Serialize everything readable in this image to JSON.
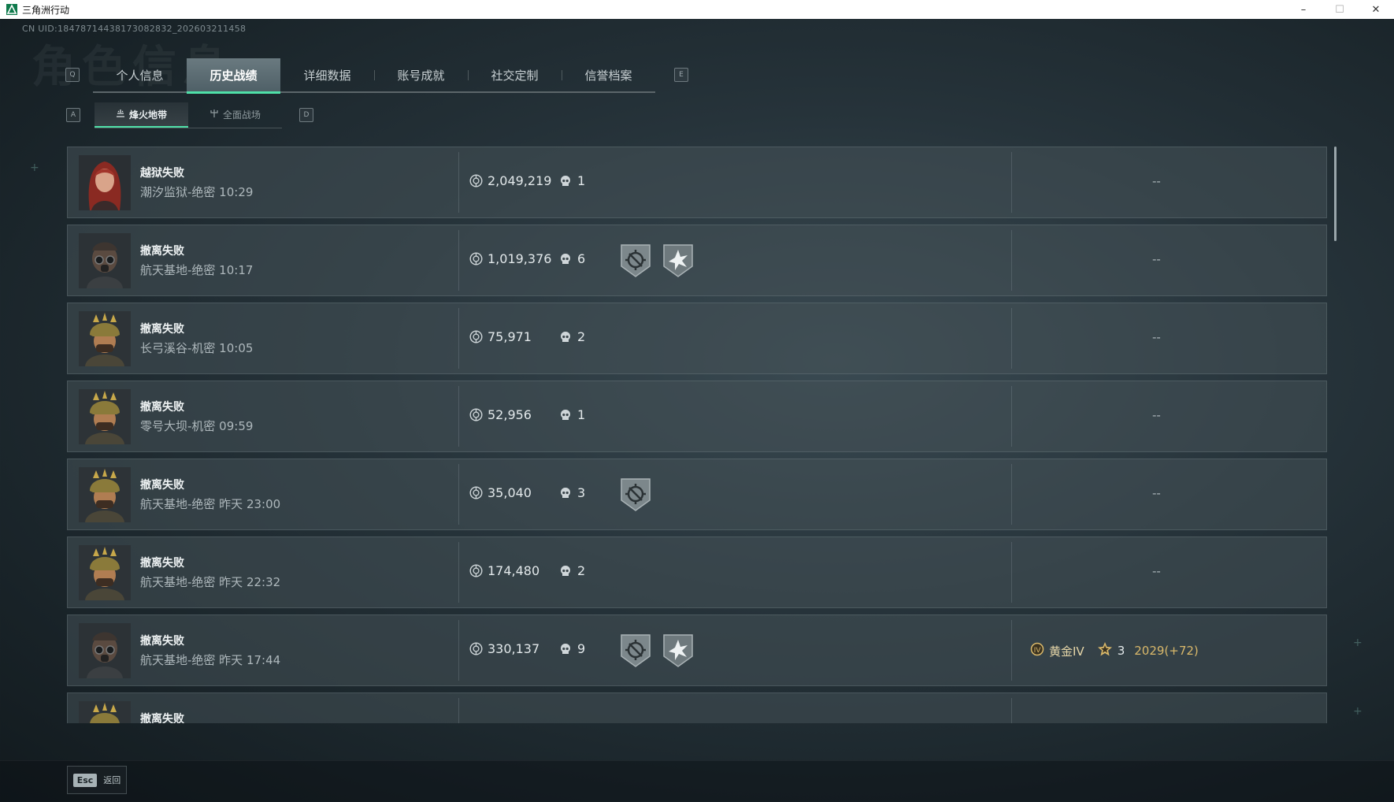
{
  "window": {
    "title": "三角洲行动",
    "minimize": "–",
    "maximize": "☐",
    "close": "✕"
  },
  "uid": "CN UID:18478714438173082832_202603211458",
  "bg_title": "角色信息",
  "key_hints": {
    "prev_tab": "Q",
    "next_tab": "E",
    "prev_sub": "A",
    "next_sub": "D"
  },
  "tabs": [
    "个人信息",
    "历史战绩",
    "详细数据",
    "账号成就",
    "社交定制",
    "信誉档案"
  ],
  "active_tab": "历史战绩",
  "subtabs": [
    "烽火地带",
    "全面战场"
  ],
  "active_subtab": "烽火地带",
  "rows": [
    {
      "result": "越狱失败",
      "map": "潮汐监狱-绝密 10:29",
      "value": "2,049,219",
      "kills": "1",
      "avatar": "female-red-hair",
      "badges": [],
      "rank_text": "--"
    },
    {
      "result": "撤离失败",
      "map": "航天基地-绝密 10:17",
      "value": "1,019,376",
      "kills": "6",
      "avatar": "gasmask-operator",
      "badges": [
        "crosshair-badge-icon",
        "burst-badge-icon"
      ],
      "rank_text": "--"
    },
    {
      "result": "撤离失败",
      "map": "长弓溪谷-机密 10:05",
      "value": "75,971",
      "kills": "2",
      "avatar": "gold-helmet-operator",
      "badges": [],
      "rank_text": "--"
    },
    {
      "result": "撤离失败",
      "map": "零号大坝-机密 09:59",
      "value": "52,956",
      "kills": "1",
      "avatar": "gold-helmet-operator",
      "badges": [],
      "rank_text": "--"
    },
    {
      "result": "撤离失败",
      "map": "航天基地-绝密 昨天 23:00",
      "value": "35,040",
      "kills": "3",
      "avatar": "gold-helmet-operator",
      "badges": [
        "crosshair-badge-icon"
      ],
      "rank_text": "--"
    },
    {
      "result": "撤离失败",
      "map": "航天基地-绝密 昨天 22:32",
      "value": "174,480",
      "kills": "2",
      "avatar": "gold-helmet-operator",
      "badges": [],
      "rank_text": "--"
    },
    {
      "result": "撤离失败",
      "map": "航天基地-绝密 昨天 17:44",
      "value": "330,137",
      "kills": "9",
      "avatar": "gasmask-operator",
      "badges": [
        "crosshair-badge-icon",
        "burst-badge-icon"
      ],
      "rank": {
        "icon": "gold-rank-icon",
        "name": "黄金IV",
        "star_icon": "star-rank-icon",
        "stars": "3",
        "score": "2029(+72)"
      }
    },
    {
      "result": "撤离失败",
      "map": "",
      "value": "",
      "kills": "",
      "avatar": "gold-helmet-operator",
      "badges": [],
      "rank_text": ""
    }
  ],
  "footer": {
    "esc_key": "Esc",
    "back_label": "返回"
  },
  "colors": {
    "accent": "#4fe0a8",
    "rank_gold": "#d9b86a",
    "panel": "#465258"
  }
}
